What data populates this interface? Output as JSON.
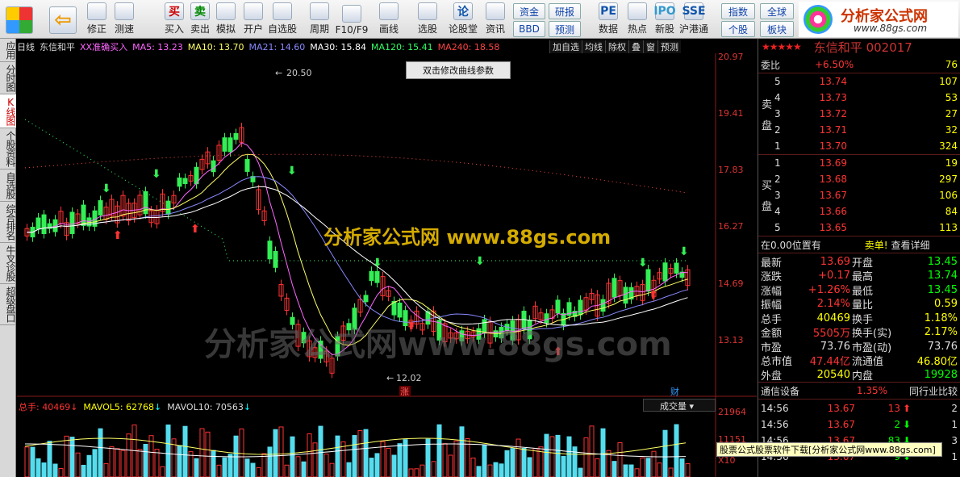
{
  "toolbar": {
    "buttons": [
      {
        "label": "",
        "icon": "windows-logo-icon"
      },
      {
        "label": "",
        "icon": "back-arrow-icon"
      },
      {
        "label": "修正",
        "icon": "up-down-arrow-icon"
      },
      {
        "label": "测速",
        "icon": "stopwatch-icon"
      },
      {
        "label": "买入",
        "icon": "buy-icon",
        "glyph": "买"
      },
      {
        "label": "卖出",
        "icon": "sell-icon",
        "glyph": "卖"
      },
      {
        "label": "模拟",
        "icon": "hammer-icon"
      },
      {
        "label": "开户",
        "icon": "lock-icon"
      },
      {
        "label": "自选股",
        "icon": "star-icon"
      },
      {
        "label": "周期",
        "icon": "clock-icon"
      },
      {
        "label": "F10/F9",
        "icon": "document-icon"
      },
      {
        "label": "画线",
        "icon": "pencil-icon"
      },
      {
        "label": "选股",
        "icon": "screen-icon"
      },
      {
        "label": "论股堂",
        "icon": "discussion-icon",
        "glyph": "论"
      },
      {
        "label": "资讯",
        "icon": "news-icon"
      },
      {
        "label": "数据",
        "icon": "pe-icon",
        "glyph": "PE"
      },
      {
        "label": "热点",
        "icon": "hot-icon"
      },
      {
        "label": "新股",
        "icon": "ipo-icon",
        "glyph": "IPO"
      },
      {
        "label": "沪港通",
        "icon": "sse-hk-icon",
        "glyph": "SSE"
      }
    ],
    "small_buttons": [
      "资金",
      "BBD",
      "研报",
      "预测",
      "指数",
      "个股",
      "全球",
      "板块"
    ],
    "logo_text": "分析家公式网",
    "logo_url_text": "www.88gs.com"
  },
  "leftnav": [
    "应用",
    "分时图",
    "K线图",
    "个股资料",
    "自选股",
    "综合排名",
    "牛叉诊股",
    "超级盘口"
  ],
  "chart": {
    "legend": [
      {
        "text": "日线",
        "color": "#dddddd"
      },
      {
        "text": "东信和平",
        "color": "#dddddd"
      },
      {
        "text": "XX准确买入",
        "color": "#ff66ff"
      },
      {
        "text": "MA5: 13.23",
        "color": "#ff66ff"
      },
      {
        "text": "MA10: 13.70",
        "color": "#ffff66"
      },
      {
        "text": "MA21: 14.60",
        "color": "#8888ff"
      },
      {
        "text": "MA30: 15.84",
        "color": "#ffffff"
      },
      {
        "text": "MA120: 15.41",
        "color": "#33ff66"
      },
      {
        "text": "MA240: 18.58",
        "color": "#ff4444"
      }
    ],
    "menu": [
      "加自选",
      "均线",
      "除权",
      "叠",
      "窗",
      "预测"
    ],
    "tooltip": "双击修改曲线参数",
    "price_axis": [
      "20.97",
      "19.41",
      "17.83",
      "16.27",
      "14.69",
      "13.13"
    ],
    "high_mark": "20.50",
    "low_mark": "12.02",
    "watermark1": "分析家公式网  www.88gs.com",
    "watermark2": "分析家公式网www.88gs.com",
    "badge_rise": "涨",
    "badge_fin": "财",
    "volume": {
      "total_label": "总手: 40469",
      "mavol5": "MAVOL5: 62768",
      "mavol10": "MAVOL10: 70563",
      "selector": "成交量",
      "axis": [
        "21964",
        "11151",
        "X10"
      ]
    }
  },
  "quote": {
    "title": "东信和平 002017",
    "webi": {
      "label": "委比",
      "pct": "+6.50%",
      "diff": "76"
    },
    "sell_label": "卖盘",
    "buy_label": "买盘",
    "asks": [
      {
        "level": "5",
        "price": "13.74",
        "vol": "107"
      },
      {
        "level": "4",
        "price": "13.73",
        "vol": "53"
      },
      {
        "level": "3",
        "price": "13.72",
        "vol": "27"
      },
      {
        "level": "2",
        "price": "13.71",
        "vol": "32"
      },
      {
        "level": "1",
        "price": "13.70",
        "vol": "324"
      }
    ],
    "bids": [
      {
        "level": "1",
        "price": "13.69",
        "vol": "19"
      },
      {
        "level": "2",
        "price": "13.68",
        "vol": "297"
      },
      {
        "level": "3",
        "price": "13.67",
        "vol": "106"
      },
      {
        "level": "4",
        "price": "13.66",
        "vol": "84"
      },
      {
        "level": "5",
        "price": "13.65",
        "vol": "113"
      }
    ],
    "position_text": "在0.00位置有",
    "sell_notice": "卖单!",
    "detail_link": "查看详细",
    "stats": [
      [
        "最新",
        "13.69",
        "开盘",
        "13.45"
      ],
      [
        "涨跌",
        "+0.17",
        "最高",
        "13.74"
      ],
      [
        "涨幅",
        "+1.26%",
        "最低",
        "13.45"
      ],
      [
        "振幅",
        "2.14%",
        "量比",
        "0.59"
      ],
      [
        "总手",
        "40469",
        "换手",
        "1.18%"
      ],
      [
        "金额",
        "5505万",
        "换手(实)",
        "2.17%"
      ],
      [
        "市盈",
        "73.76",
        "市盈(动)",
        "73.76"
      ],
      [
        "总市值",
        "47.44亿",
        "流通值",
        "46.80亿"
      ],
      [
        "外盘",
        "20540",
        "内盘",
        "19928"
      ]
    ],
    "industry": {
      "name": "通信设备",
      "pct": "1.35%",
      "compare": "同行业比较"
    },
    "ticks": [
      {
        "time": "14:56",
        "price": "13.67",
        "vol": "13",
        "dir": "up",
        "n": "2"
      },
      {
        "time": "14:56",
        "price": "13.67",
        "vol": "2",
        "dir": "down",
        "n": "1"
      },
      {
        "time": "14:56",
        "price": "13.67",
        "vol": "83",
        "dir": "down",
        "n": "3"
      },
      {
        "time": "14:56",
        "price": "13.67",
        "vol": "9",
        "dir": "down",
        "n": "1"
      }
    ]
  },
  "banner": "股票公式股票软件下载[分析家公式网www.88gs.com]"
}
